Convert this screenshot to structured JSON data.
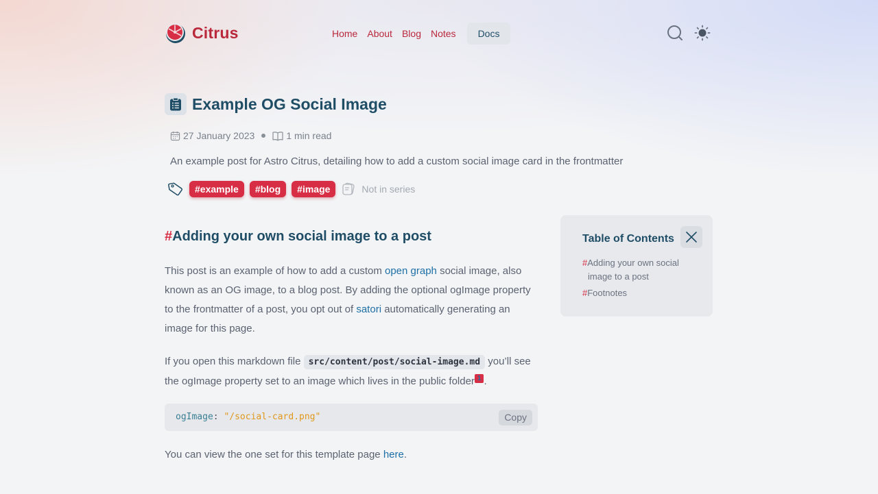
{
  "colors": {
    "accent": "#d72e45",
    "heading": "#1f4d66",
    "link": "#1d6fa5"
  },
  "header": {
    "logo_text": "Citrus",
    "nav": [
      {
        "label": "Home"
      },
      {
        "label": "About"
      },
      {
        "label": "Blog"
      },
      {
        "label": "Notes"
      }
    ],
    "docs_label": "Docs",
    "icons": [
      "search-icon",
      "sun-icon"
    ]
  },
  "post": {
    "title": "Example OG Social Image",
    "date": "27 January 2023",
    "read_time": "1 min read",
    "description": "An example post for Astro Citrus, detailing how to add a custom social image card in the frontmatter",
    "tags": [
      "#example",
      "#blog",
      "#image"
    ],
    "series": "Not in series"
  },
  "article": {
    "heading_hash": "#",
    "heading": "Adding your own social image to a post",
    "p1": {
      "t1": "This post is an example of how to add a custom ",
      "link1": "open graph",
      "t2": " social image, also known as an OG image, to a blog post. By adding the optional ogImage property to the frontmatter of a post, you opt out of ",
      "link2": "satori",
      "t3": " automatically generating an image for this page."
    },
    "p2": {
      "t1": "If you open this markdown file ",
      "code": "src/content/post/social-image.md",
      "t2": " you’ll see the ogImage property set to an image which lives in the public folder",
      "footnote": "1",
      "t3": "."
    },
    "codeblock": {
      "key": "ogImage",
      "colon": ": ",
      "value": "\"/social-card.png\"",
      "copy_label": "Copy"
    },
    "p3": {
      "t1": "You can view the one set for this template page ",
      "link": "here",
      "t2": "."
    }
  },
  "toc": {
    "title": "Table of Contents",
    "items": [
      {
        "hash": "#",
        "label_line1": "Adding your own social",
        "label_line2": "image to a post"
      },
      {
        "hash": "#",
        "label_line1": "Footnotes"
      }
    ]
  }
}
